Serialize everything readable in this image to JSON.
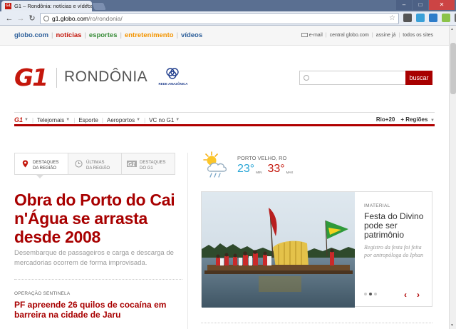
{
  "browser": {
    "tab_title": "G1 – Rondônia: notícias e vídeos",
    "favicon": "G1",
    "url_host": "g1.globo.com",
    "url_path": "/ro/rondonia/"
  },
  "globo_bar": {
    "links": [
      {
        "label": "globo.com",
        "color": "#2d5f9a"
      },
      {
        "label": "notícias",
        "color": "#c4170c"
      },
      {
        "label": "esportes",
        "color": "#3a8d3a"
      },
      {
        "label": "entretenimento",
        "color": "#f39400"
      },
      {
        "label": "vídeos",
        "color": "#2d5f9a"
      }
    ],
    "right": [
      "e-mail",
      "central globo.com",
      "assine já",
      "todos os sites"
    ]
  },
  "header": {
    "logo": "G1",
    "region": "RONDÔNIA",
    "affiliate": "REDE AMAZÔNICA",
    "search_button": "buscar"
  },
  "section_nav": {
    "logo": "G1",
    "items": [
      "Telejornais",
      "Esporte",
      "Aeroportos",
      "VC no G1"
    ],
    "right": [
      "Rio+20",
      "+ Regiões"
    ]
  },
  "tabs": [
    {
      "line1": "DESTAQUES",
      "line2": "DA REGIÃO",
      "icon": "location-pin-icon"
    },
    {
      "line1": "ÚLTIMAS",
      "line2": "DA REGIÃO",
      "icon": "clock-icon"
    },
    {
      "line1": "DESTAQUES",
      "line2": "DO G1",
      "icon": "g1-icon"
    }
  ],
  "main": {
    "headline": "Obra do Porto do Cai n'Água se arrasta desde 2008",
    "summary": "Desembarque de passageiros e carga e descarga de mercadorias ocorrem de forma improvisada.",
    "kicker": "OPERAÇÃO SENTINELA",
    "subheadline": "PF apreende 26 quilos de cocaína em barreira na cidade de Jaru"
  },
  "weather": {
    "city": "PORTO VELHO, RO",
    "min": "23°",
    "min_label": "MIN",
    "max": "33°",
    "max_label": "MAX",
    "icon": "sun-cloud-rain-icon"
  },
  "feature": {
    "category": "IMATERIAL",
    "title": "Festa do Divino pode ser patrimônio",
    "description": "Registro da festa foi feita por antropóloga do Iphan",
    "arrow_prev": "‹",
    "arrow_next": "›"
  }
}
